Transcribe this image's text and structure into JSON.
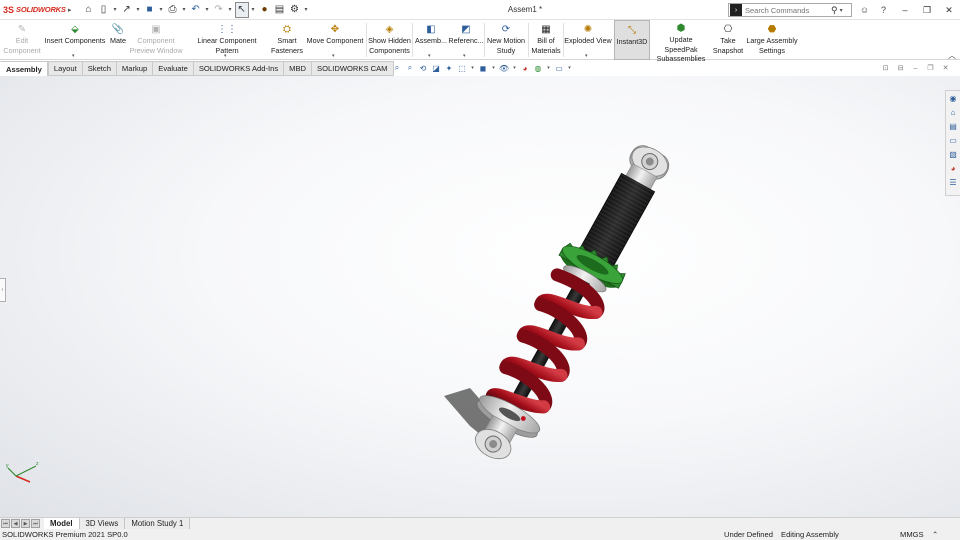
{
  "app": {
    "brand": "SOLIDWORKS",
    "document_title": "Assem1 *"
  },
  "search": {
    "placeholder": "Search Commands"
  },
  "ribbon": {
    "buttons": [
      {
        "label": "Edit\nComponent",
        "icon": "edit-component-icon",
        "disabled": true
      },
      {
        "label": "Insert Components",
        "icon": "insert-components-icon"
      },
      {
        "label": "Mate",
        "icon": "mate-icon"
      },
      {
        "label": "Component\nPreview Window",
        "icon": "preview-window-icon",
        "disabled": true
      },
      {
        "label": "Linear Component Pattern",
        "icon": "linear-pattern-icon"
      },
      {
        "label": "Smart\nFasteners",
        "icon": "smart-fasteners-icon"
      },
      {
        "label": "Move Component",
        "icon": "move-component-icon"
      },
      {
        "label": "Show Hidden\nComponents",
        "icon": "show-hidden-icon"
      },
      {
        "label": "Assemb...",
        "icon": "assembly-features-icon"
      },
      {
        "label": "Referenc...",
        "icon": "reference-geometry-icon"
      },
      {
        "label": "New Motion\nStudy",
        "icon": "motion-study-icon"
      },
      {
        "label": "Bill of\nMaterials",
        "icon": "bom-icon"
      },
      {
        "label": "Exploded View",
        "icon": "exploded-view-icon"
      },
      {
        "label": "Instant3D",
        "icon": "instant3d-icon",
        "active": true
      },
      {
        "label": "Update SpeedPak\nSubassemblies",
        "icon": "speedpak-icon"
      },
      {
        "label": "Take\nSnapshot",
        "icon": "snapshot-icon"
      },
      {
        "label": "Large Assembly\nSettings",
        "icon": "large-assembly-icon"
      }
    ]
  },
  "tabs": [
    "Assembly",
    "Layout",
    "Sketch",
    "Markup",
    "Evaluate",
    "SOLIDWORKS Add-Ins",
    "MBD",
    "SOLIDWORKS CAM"
  ],
  "bottom_tabs": [
    "Model",
    "3D Views",
    "Motion Study 1"
  ],
  "status": {
    "version": "SOLIDWORKS Premium 2021 SP0.0",
    "definition": "Under Defined",
    "mode": "Editing Assembly",
    "units": "MMGS"
  },
  "colors": {
    "spring": "#b0121e",
    "gear": "#2f8a2f",
    "thread": "#1b1b1b",
    "metal": "#c9c9c9",
    "accent": "#2e5f9b"
  }
}
